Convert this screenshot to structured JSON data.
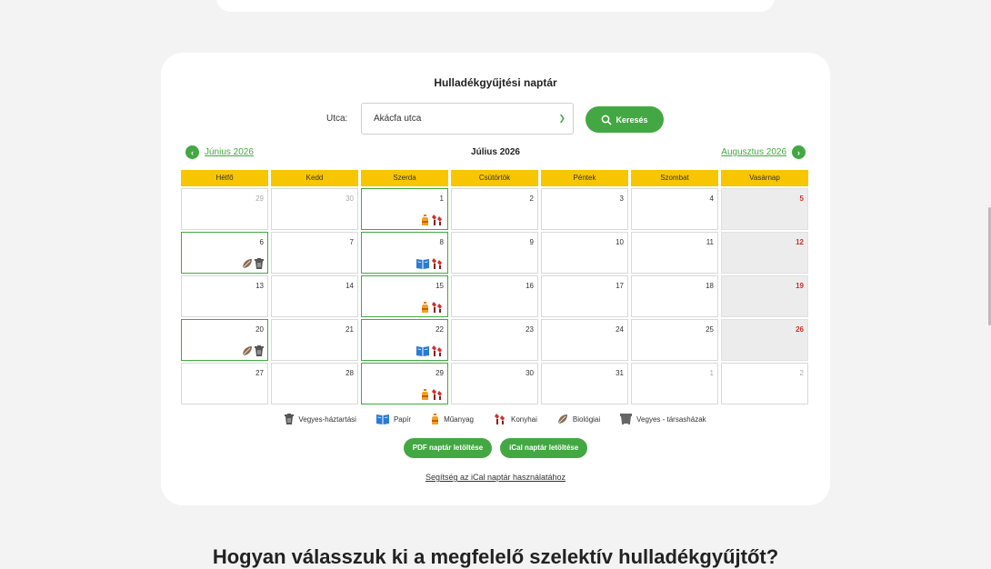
{
  "calendar": {
    "title": "Hulladékgyűjtési naptár",
    "street_label": "Utca:",
    "street_value": "Akácfa utca",
    "search_label": "Keresés",
    "prev_month": "Június 2026",
    "current_month": "Július 2026",
    "next_month": "Augusztus 2026",
    "weekdays": [
      "Hétfő",
      "Kedd",
      "Szerda",
      "Csütörtök",
      "Péntek",
      "Szombat",
      "Vasárnap"
    ],
    "weeks": [
      [
        "29",
        "30",
        "1",
        "2",
        "3",
        "4",
        "5"
      ],
      [
        "6",
        "7",
        "8",
        "9",
        "10",
        "11",
        "12"
      ],
      [
        "13",
        "14",
        "15",
        "16",
        "17",
        "18",
        "19"
      ],
      [
        "20",
        "21",
        "22",
        "23",
        "24",
        "25",
        "26"
      ],
      [
        "27",
        "28",
        "29",
        "30",
        "31",
        "1",
        "2"
      ]
    ]
  },
  "legend": {
    "mixed": "Vegyes-háztartási",
    "paper": "Papír",
    "plastic": "Műanyag",
    "kitchen": "Konyhai",
    "bio": "Biológiai",
    "mixed_condo": "Vegyes - társasházak"
  },
  "actions": {
    "pdf": "PDF naptár letöltése",
    "ical": "iCal naptár letöltése",
    "help": "Segítség az iCal naptár használatához"
  },
  "colors": {
    "accent": "#43a843",
    "header_yellow": "#f7c600",
    "sunday_red": "#d32f2f"
  },
  "bottom": {
    "heading": "Hogyan válasszuk ki a megfelelő szelektív hulladékgyűjtőt?"
  }
}
